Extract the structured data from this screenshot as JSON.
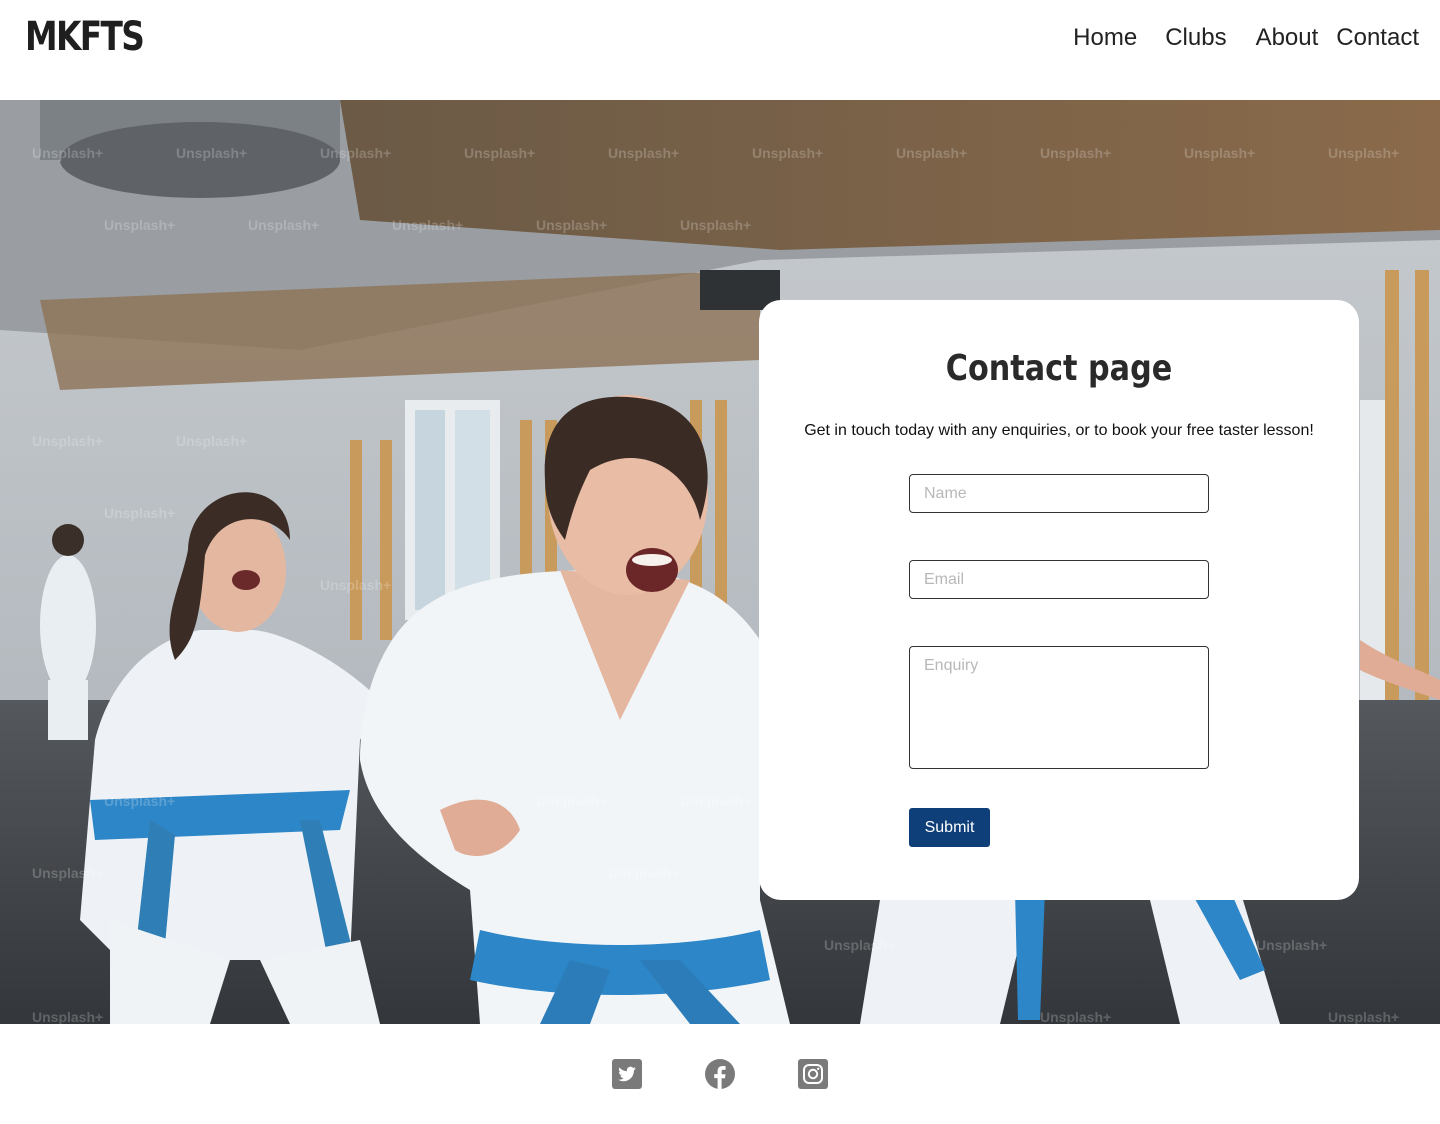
{
  "brand": {
    "name": "MKFTS"
  },
  "nav": {
    "items": [
      "Home",
      "Clubs",
      "About",
      "Contact"
    ]
  },
  "hero": {
    "watermark": "Unsplash+"
  },
  "contact": {
    "title": "Contact page",
    "intro": "Get in touch today with any enquiries, or to book your free taster lesson!",
    "name_placeholder": "Name",
    "email_placeholder": "Email",
    "enquiry_placeholder": "Enquiry",
    "submit_label": "Submit"
  },
  "footer": {
    "social": [
      "twitter-icon",
      "facebook-icon",
      "instagram-icon"
    ]
  },
  "colors": {
    "accent": "#0f3f78",
    "icon_gray": "#7a7a7a",
    "belt_blue": "#2d86c7"
  }
}
